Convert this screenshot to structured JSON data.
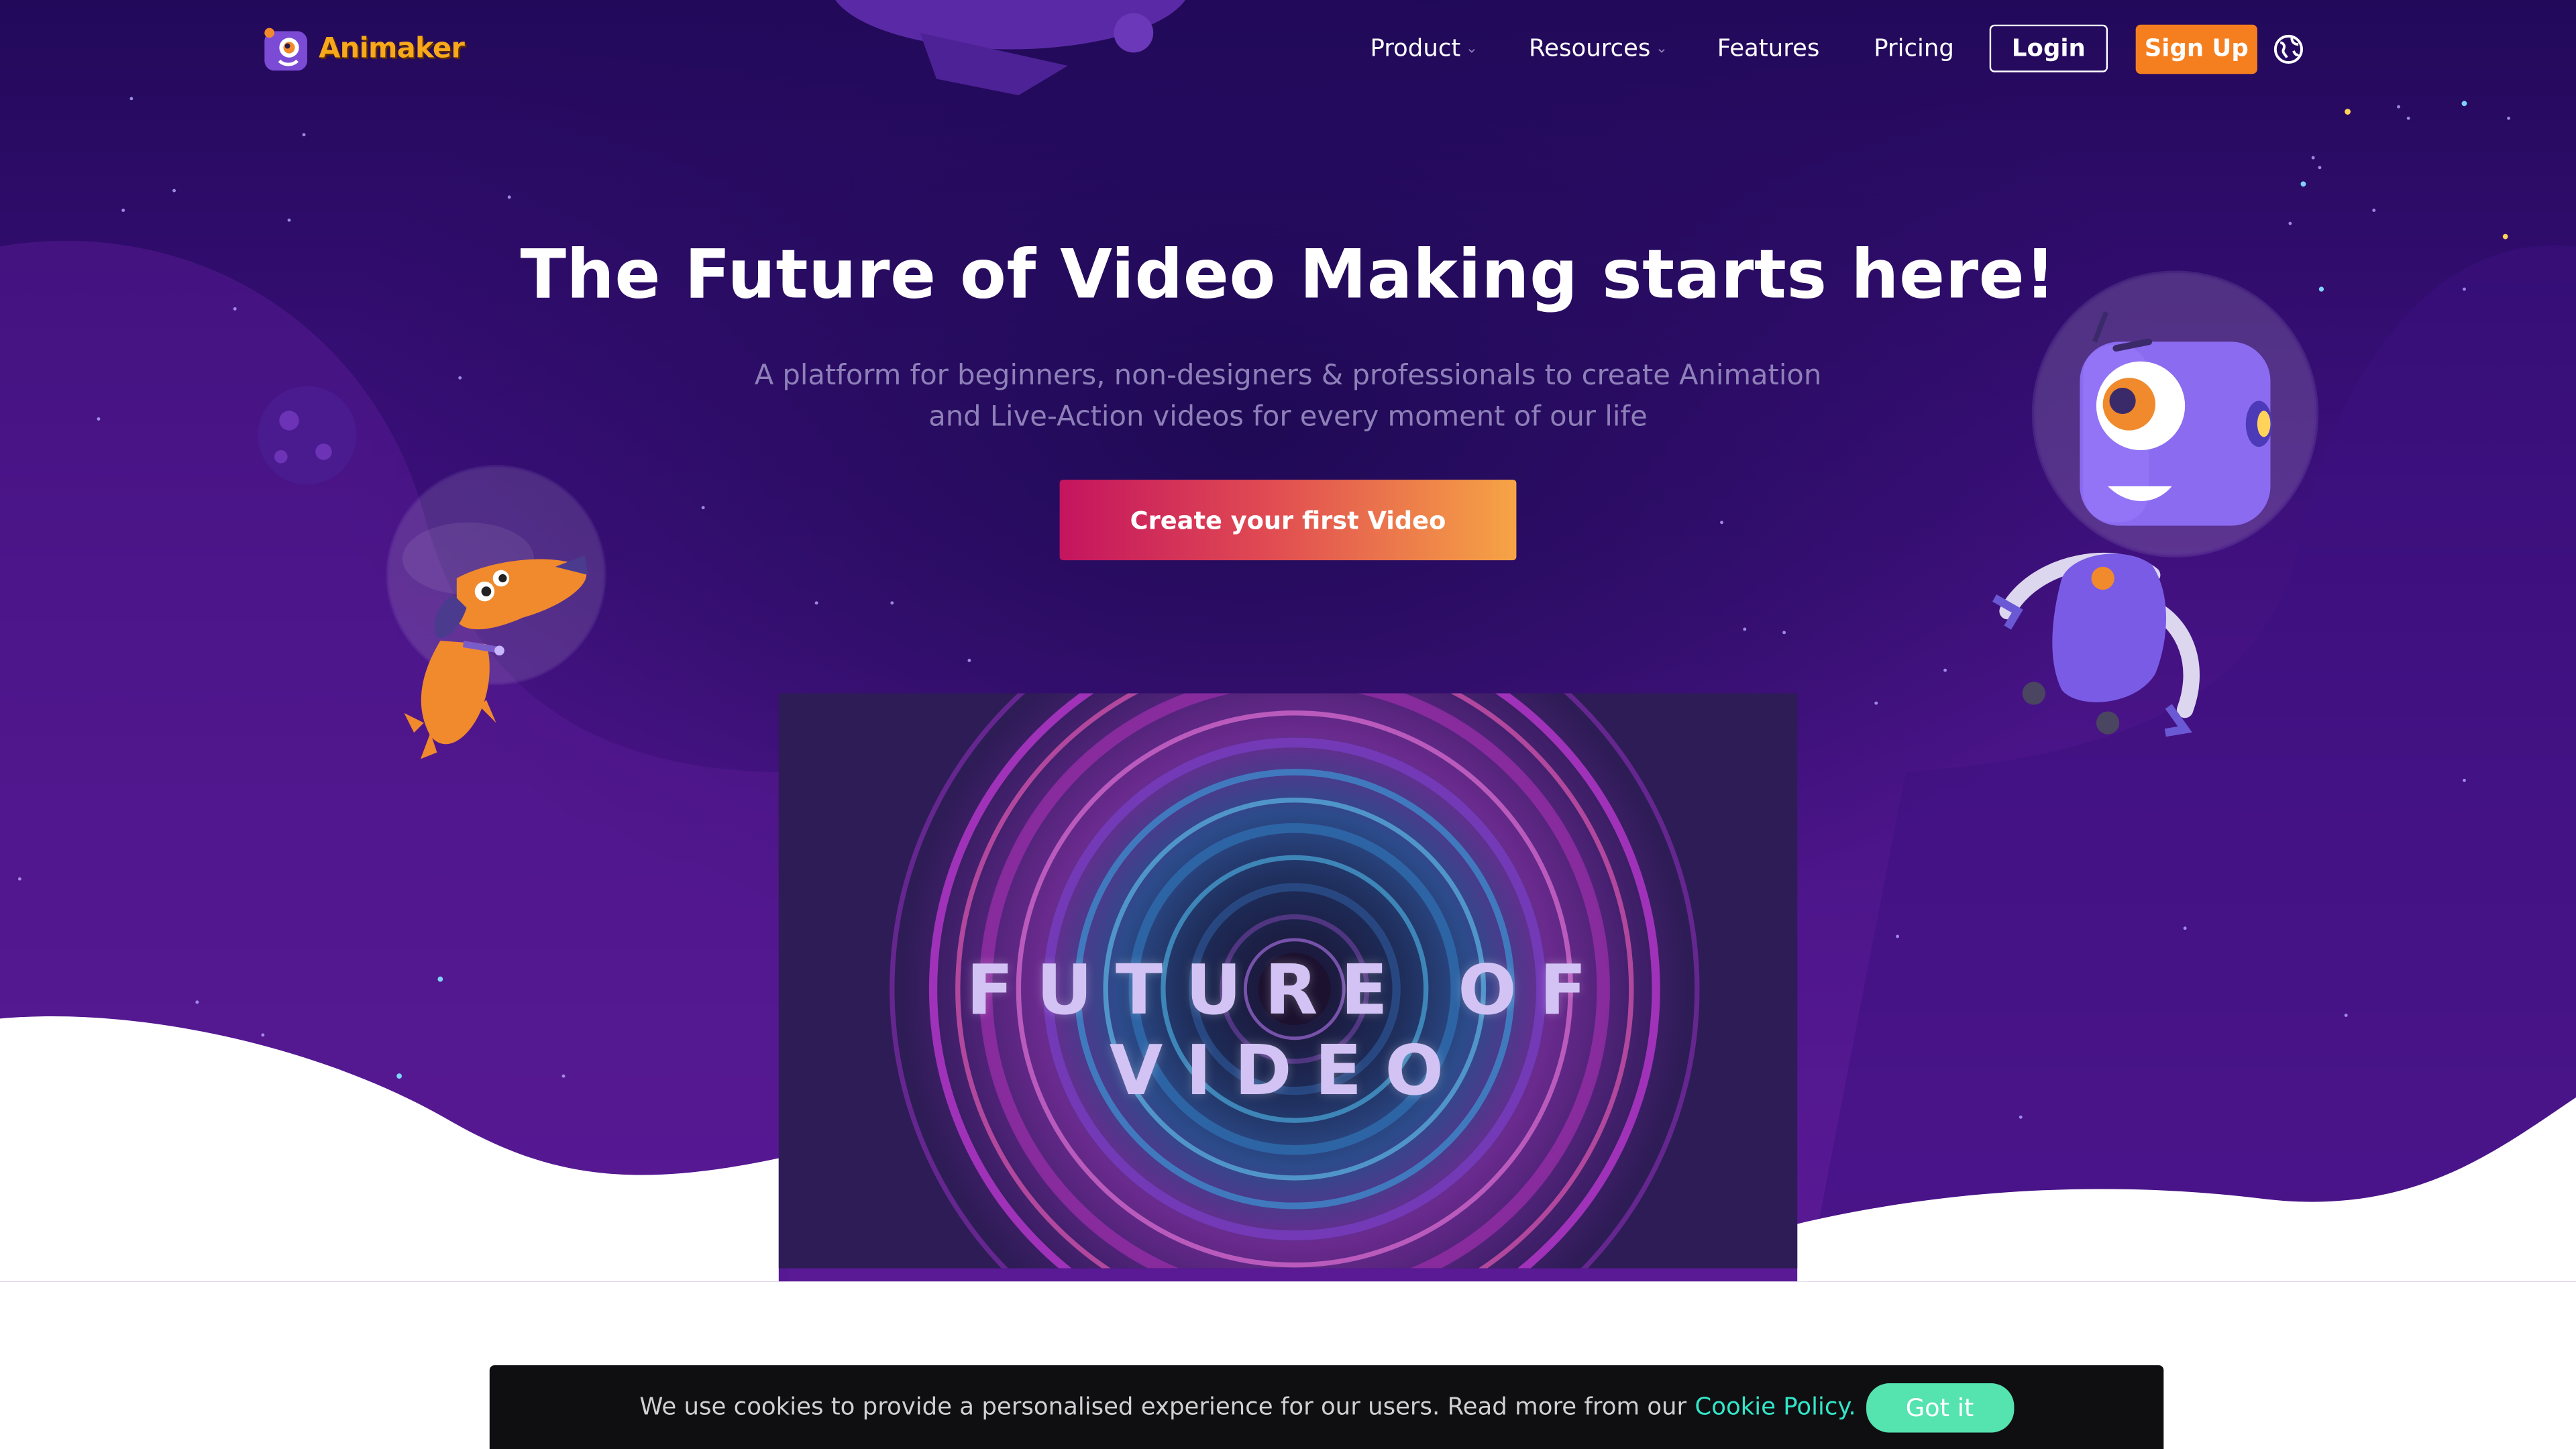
{
  "brand": {
    "name": "Animaker"
  },
  "nav": {
    "items": [
      {
        "label": "Product",
        "has_dropdown": true
      },
      {
        "label": "Resources",
        "has_dropdown": true
      },
      {
        "label": "Features",
        "has_dropdown": false
      },
      {
        "label": "Pricing",
        "has_dropdown": false
      }
    ],
    "login_label": "Login",
    "signup_label": "Sign Up",
    "language_icon": "globe-icon"
  },
  "hero": {
    "title": "The Future of Video Making starts here!",
    "subtitle_line1": "A platform for beginners, non-designers & professionals to create Animation",
    "subtitle_line2": "and Live-Action videos for every moment of our life",
    "cta_label": "Create your first Video"
  },
  "video": {
    "overlay_text": "FUTURE OF VIDEO"
  },
  "cookie_banner": {
    "message": "We use cookies to provide a personalised experience for our users. Read more from our",
    "link_label": "Cookie Policy.",
    "button_label": "Got it"
  },
  "colors": {
    "hero_bg": "#3a0f79",
    "signup_bg": "#f57f1f",
    "cta_start": "#c4145f",
    "cta_end": "#f6a445",
    "cookie_link": "#33e6c8",
    "cookie_button": "#55e3b0"
  }
}
